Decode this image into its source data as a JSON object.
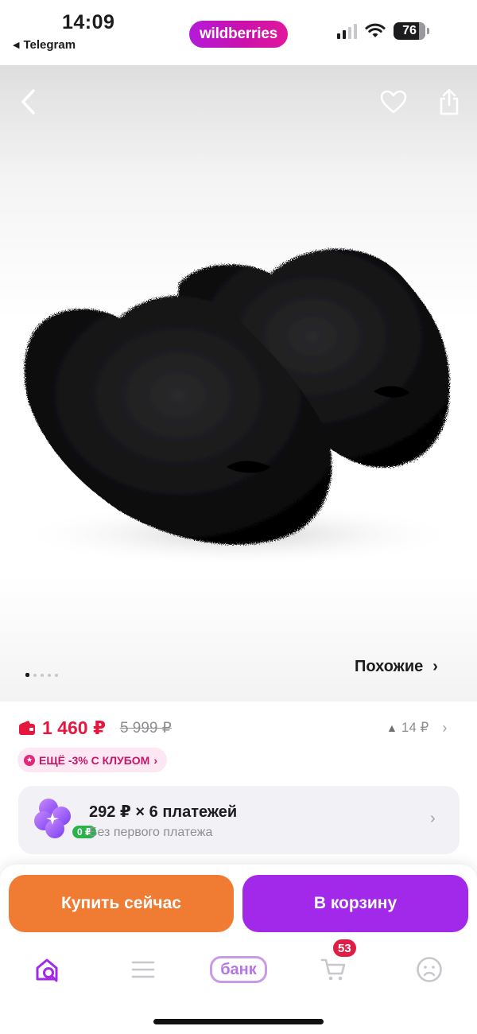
{
  "status_bar": {
    "time": "14:09",
    "back_app": "Telegram",
    "brand": "wildberries",
    "battery": "76"
  },
  "gallery": {
    "similar_label": "Похожие",
    "dot_count": 5,
    "active_dot": 0,
    "icons": [
      "back-arrow-icon",
      "heart-icon",
      "share-icon"
    ]
  },
  "price": {
    "current": "1 460 ₽",
    "old": "5 999 ₽",
    "delta": "14 ₽",
    "colors": {
      "current": "#e5173f",
      "old": "#8e8e93"
    }
  },
  "club_badge": {
    "label": "ЕЩЁ -3% С КЛУБОМ"
  },
  "installments": {
    "title": "292 ₽ × 6 платежей",
    "subtitle": "Без первого платежа",
    "zero_badge": "0 ₽"
  },
  "actions": {
    "buy_now": "Купить сейчас",
    "add_to_cart": "В корзину",
    "colors": {
      "buy_now": "#f07c33",
      "add_to_cart": "#a229ea"
    }
  },
  "tabbar": {
    "items": [
      "home-search",
      "catalog",
      "bank",
      "cart",
      "profile"
    ],
    "bank_label": "банк",
    "cart_count": "53",
    "active": "home-search"
  }
}
